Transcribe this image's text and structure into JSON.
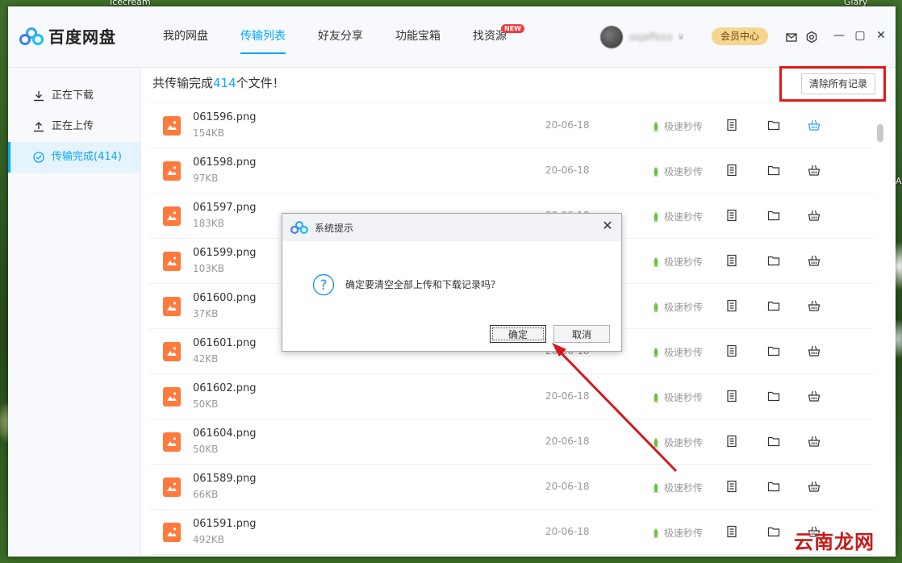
{
  "desktop": {
    "top_left_text": "Icecream",
    "top_right_text": "Glary",
    "right_edge_text": "A"
  },
  "app": {
    "logo_text": "百度网盘",
    "nav": [
      {
        "label": "我的网盘"
      },
      {
        "label": "传输列表"
      },
      {
        "label": "好友分享"
      },
      {
        "label": "功能宝箱"
      },
      {
        "label": "找资源",
        "badge": "NEW"
      }
    ],
    "active_nav": "传输列表",
    "user": {
      "name": "sxjeffxxx"
    },
    "vip_label": "会员中心",
    "accent": "#06a7ff"
  },
  "sidebar": {
    "items": [
      {
        "label": "正在下载",
        "icon": "download-icon"
      },
      {
        "label": "正在上传",
        "icon": "upload-icon"
      },
      {
        "label": "传输完成(414)",
        "icon": "check-circle-icon"
      }
    ]
  },
  "main": {
    "summary_prefix": "共传输完成",
    "summary_count": "414",
    "summary_suffix": "个文件！",
    "clear_button": "清除所有记录",
    "files": [
      {
        "name": "061596.png",
        "size": "154KB",
        "date": "20-06-18",
        "speed": "极速秒传"
      },
      {
        "name": "061598.png",
        "size": "97KB",
        "date": "20-06-18",
        "speed": "极速秒传"
      },
      {
        "name": "061597.png",
        "size": "183KB",
        "date": "20-06-18",
        "speed": "极速秒传"
      },
      {
        "name": "061599.png",
        "size": "103KB",
        "date": "20-06-18",
        "speed": "极速秒传"
      },
      {
        "name": "061600.png",
        "size": "37KB",
        "date": "20-06-18",
        "speed": "极速秒传"
      },
      {
        "name": "061601.png",
        "size": "42KB",
        "date": "20-06-18",
        "speed": "极速秒传"
      },
      {
        "name": "061602.png",
        "size": "50KB",
        "date": "20-06-18",
        "speed": "极速秒传"
      },
      {
        "name": "061604.png",
        "size": "50KB",
        "date": "20-06-18",
        "speed": "极速秒传"
      },
      {
        "name": "061589.png",
        "size": "66KB",
        "date": "20-06-18",
        "speed": "极速秒传"
      },
      {
        "name": "061591.png",
        "size": "492KB",
        "date": "20-06-18",
        "speed": "极速秒传"
      }
    ]
  },
  "dialog": {
    "title": "系统提示",
    "message": "确定要清空全部上传和下载记录吗？",
    "ok": "确定",
    "cancel": "取消"
  },
  "watermark": "云南龙网"
}
